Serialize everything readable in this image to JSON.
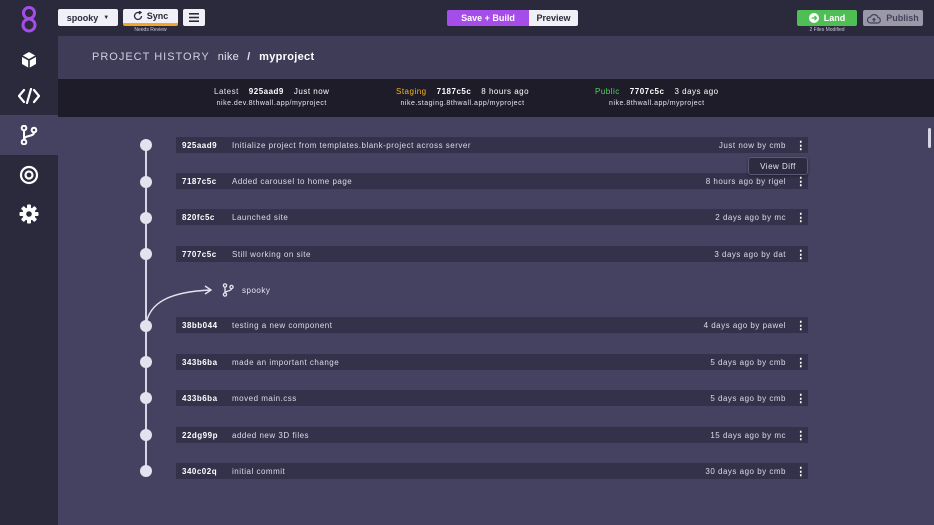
{
  "toolbar": {
    "branch": "spooky",
    "sync_label": "Sync",
    "sync_status": "Needs Review",
    "save_build_label": "Save + Build",
    "preview_label": "Preview",
    "land_label": "Land",
    "land_status": "2 Files Modified",
    "publish_label": "Publish"
  },
  "header": {
    "title": "PROJECT HISTORY",
    "org": "nike",
    "separator": "/",
    "project": "myproject"
  },
  "environments": [
    {
      "label": "Latest",
      "hash": "925aad9",
      "time": "Just now",
      "url": "nike.dev.8thwall.app/myproject"
    },
    {
      "label": "Staging",
      "hash": "7187c5c",
      "time": "8 hours ago",
      "url": "nike.staging.8thwall.app/myproject"
    },
    {
      "label": "Public",
      "hash": "7707c5c",
      "time": "3 days ago",
      "url": "nike.8thwall.app/myproject"
    }
  ],
  "commits": [
    {
      "hash": "925aad9",
      "message": "Initialize project from templates.blank-project across server",
      "meta": "Just now by cmb"
    },
    {
      "hash": "7187c5c",
      "message": "Added carousel to home page",
      "meta": "8 hours ago by rigel"
    },
    {
      "hash": "820fc5c",
      "message": "Launched site",
      "meta": "2 days ago by mc"
    },
    {
      "hash": "7707c5c",
      "message": "Still working on site",
      "meta": "3 days ago by dat"
    },
    {
      "hash": "38bb044",
      "message": "testing a new component",
      "meta": "4 days ago by pawel"
    },
    {
      "hash": "343b6ba",
      "message": "made an important change",
      "meta": "5 days ago by cmb"
    },
    {
      "hash": "433b6ba",
      "message": "moved main.css",
      "meta": "5 days ago by cmb"
    },
    {
      "hash": "22dg99p",
      "message": "added new 3D files",
      "meta": "15 days ago by mc"
    },
    {
      "hash": "340c02q",
      "message": "initial commit",
      "meta": "30 days ago by cmb"
    }
  ],
  "branch_marker": {
    "name": "spooky"
  },
  "context_menu": {
    "view_diff": "View Diff"
  },
  "colors": {
    "accent": "#a54de8",
    "land": "#4fbf55",
    "staging": "#f5b323",
    "public": "#58d163",
    "sync_warning": "#f5a623"
  },
  "icons": {
    "sidebar": [
      "cube-icon",
      "code-icon",
      "branch-icon",
      "target-icon",
      "gear-icon"
    ]
  }
}
